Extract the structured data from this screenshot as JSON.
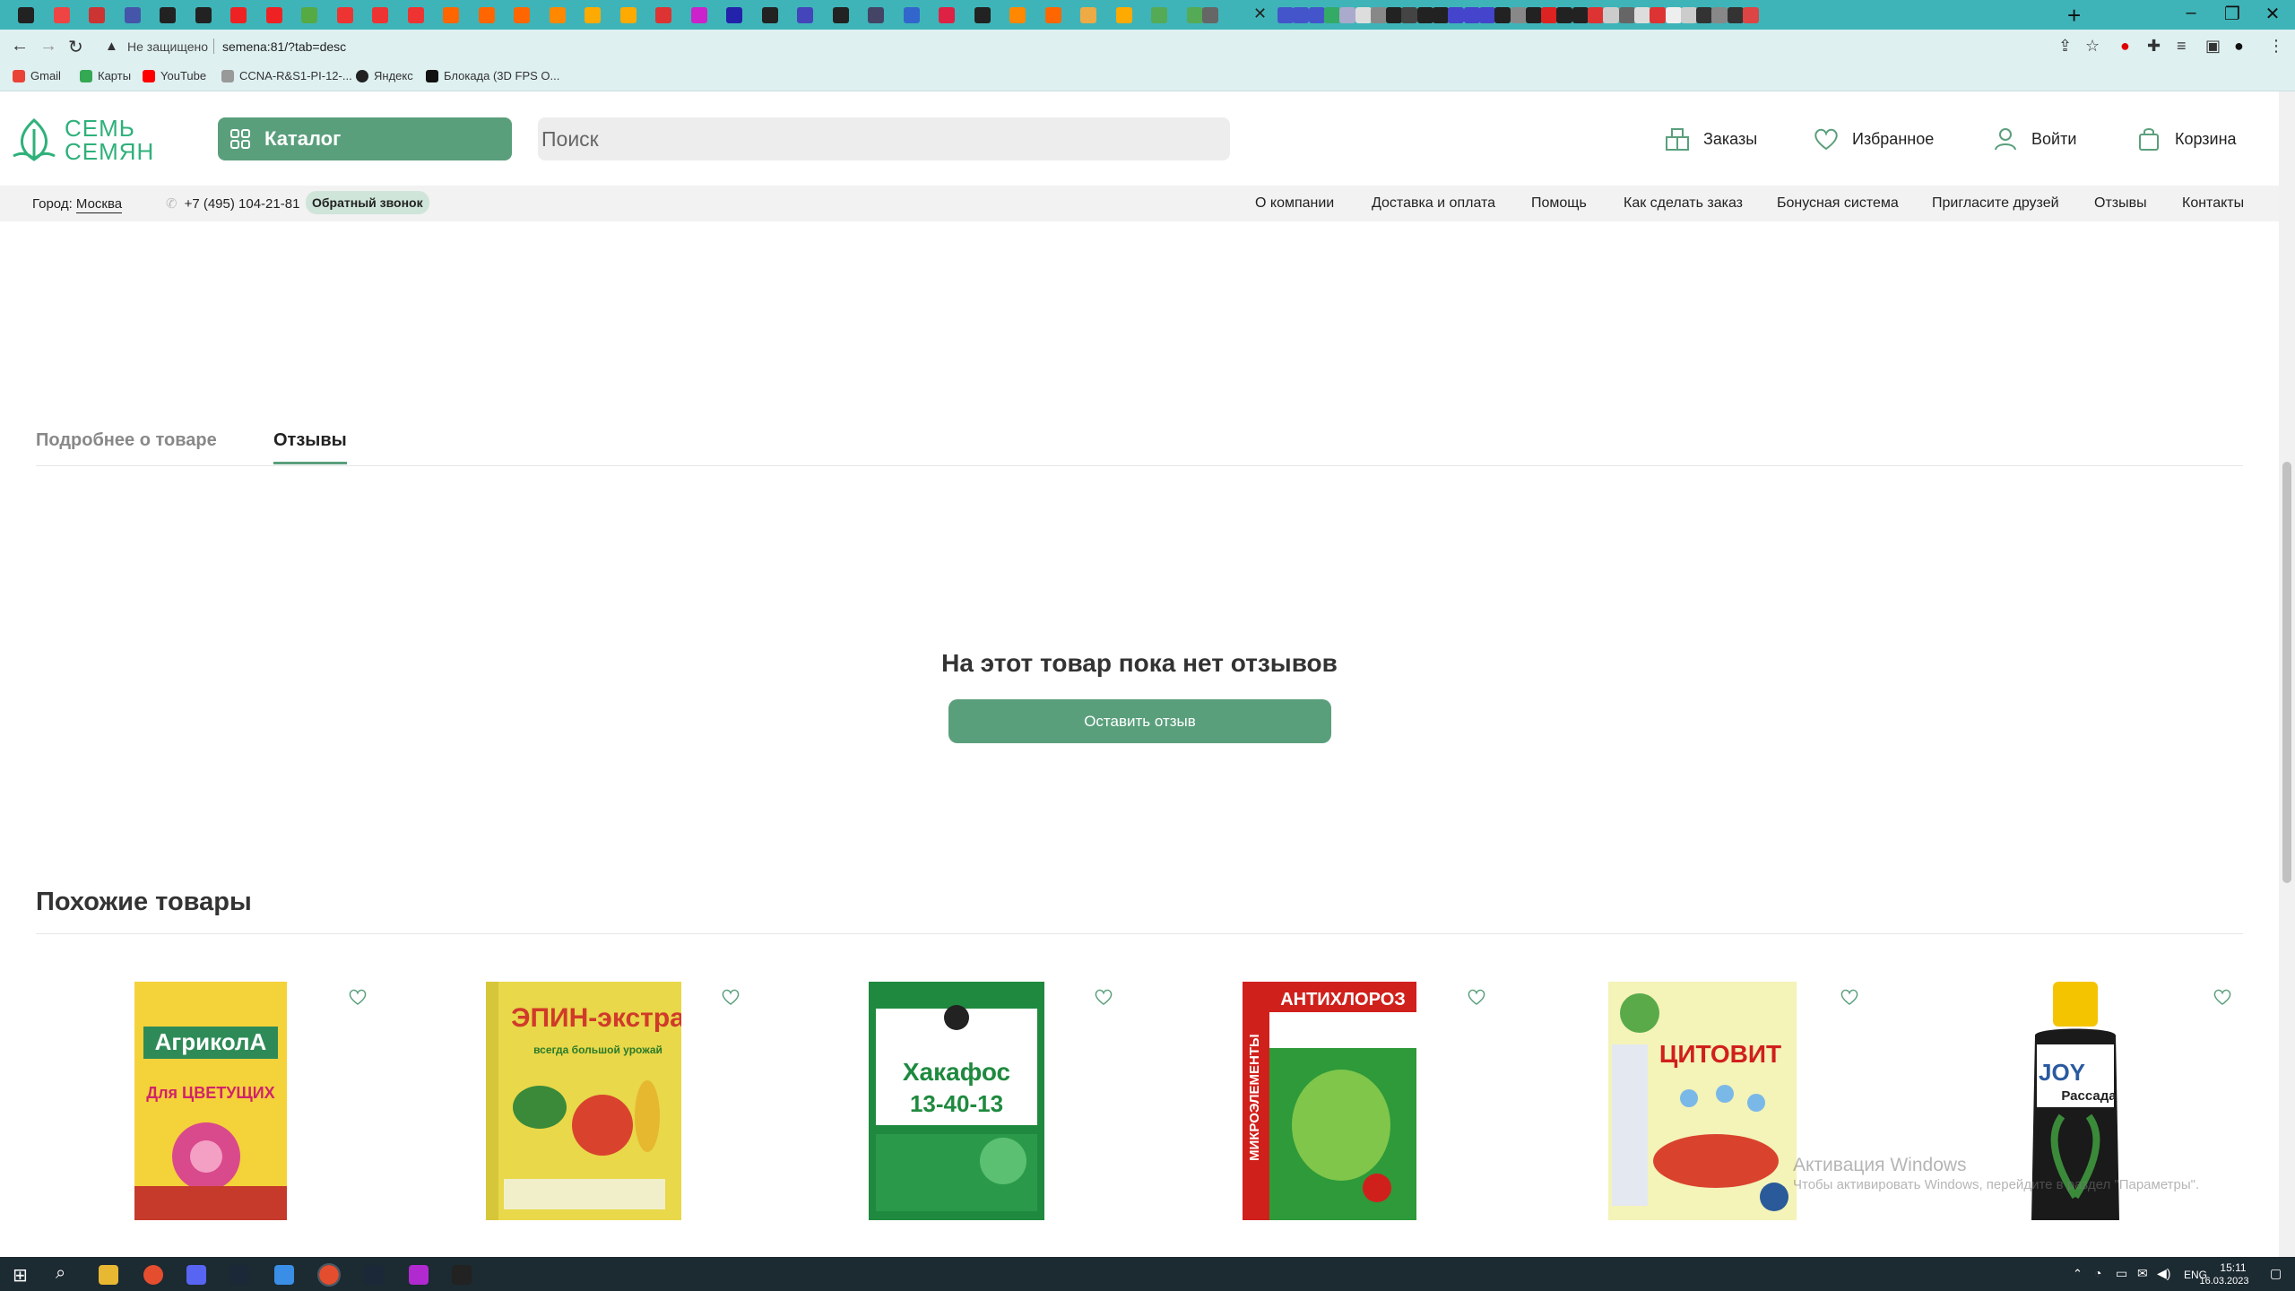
{
  "browser": {
    "url_security": "Не защищено",
    "url": "semena:81/?tab=desc",
    "bookmarks": [
      "Gmail",
      "Карты",
      "YouTube",
      "CCNA-R&S1-PI-12-...",
      "Яндекс",
      "Блокада (3D FPS O..."
    ]
  },
  "header": {
    "logo_line1": "СЕМЬ",
    "logo_line2": "СЕМЯН",
    "catalog_label": "Каталог",
    "search_placeholder": "Поиск",
    "orders_label": "Заказы",
    "favorites_label": "Избранное",
    "login_label": "Войти",
    "cart_label": "Корзина"
  },
  "subnav": {
    "city_label": "Город:",
    "city_value": "Москва",
    "phone": "+7 (495) 104-21-81",
    "callback_label": "Обратный звонок",
    "links": [
      "О компании",
      "Доставка и оплата",
      "Помощь",
      "Как сделать заказ",
      "Бонусная система",
      "Пригласите друзей",
      "Отзывы",
      "Контакты"
    ]
  },
  "tabs": {
    "details": "Подробнее о товаре",
    "reviews": "Отзывы"
  },
  "reviews": {
    "empty_text": "На этот товар пока нет отзывов",
    "leave_review_label": "Оставить отзыв"
  },
  "similar": {
    "title": "Похожие товары",
    "products": [
      {
        "package_text": "АгриколА",
        "package_sub": "Для ЦВЕТУЩИХ"
      },
      {
        "package_text": "ЭПИН-экстра",
        "package_sub": "всегда большой урожай"
      },
      {
        "package_text": "Хакафос",
        "package_sub": "13-40-13"
      },
      {
        "package_text": "АНТИХЛОРОЗ",
        "package_sub": "МИКРОЭЛЕМЕНТЫ"
      },
      {
        "package_text": "ЦИТОВИТ",
        "package_sub": ""
      },
      {
        "package_text": "JOY",
        "package_sub": "Рассада"
      }
    ]
  },
  "watermark": {
    "line1": "Активация Windows",
    "line2": "Чтобы активировать Windows, перейдите в раздел \"Параметры\"."
  },
  "taskbar": {
    "lang": "ENG",
    "time": "15:11",
    "date": "16.03.2023"
  }
}
